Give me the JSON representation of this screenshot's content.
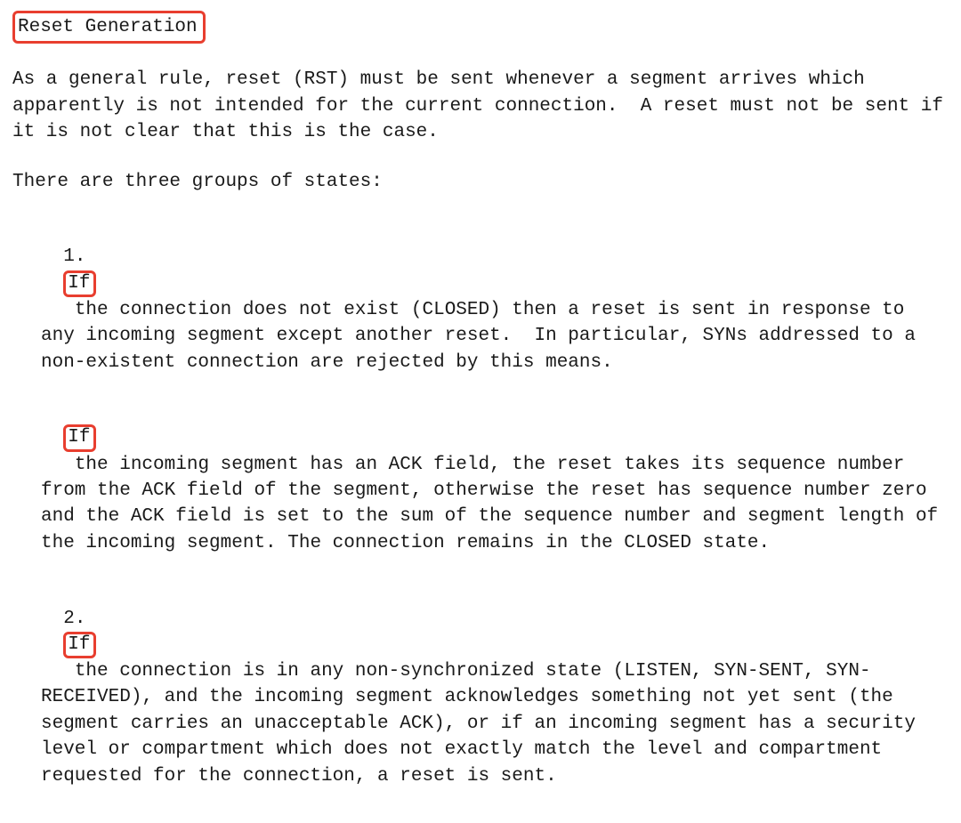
{
  "title": "Reset Generation",
  "intro": "As a general rule, reset (RST) must be sent whenever a segment arrives which apparently is not intended for the current connection.  A reset must not be sent if it is not clear that this is the case.",
  "lead": "There are three groups of states:",
  "items": [
    {
      "num": "1.",
      "highlight": "If",
      "body": "the connection does not exist (CLOSED) then a reset is sent in response to any incoming segment except another reset.  In particular, SYNs addressed to a non-existent connection are rejected by this means.",
      "extra": {
        "highlight": "If",
        "body": "the incoming segment has an ACK field, the reset takes its sequence number from the ACK field of the segment, otherwise the reset has sequence number zero and the ACK field is set to the sum of the sequence number and segment length of the incoming segment. The connection remains in the CLOSED state."
      }
    },
    {
      "num": "2.",
      "highlight": "If",
      "body": "the connection is in any non-synchronized state (LISTEN, SYN-SENT, SYN-RECEIVED), and the incoming segment acknowledges something not yet sent (the segment carries an unacceptable ACK), or if an incoming segment has a security level or compartment which does not exactly match the level and compartment requested for the connection, a reset is sent."
    }
  ]
}
